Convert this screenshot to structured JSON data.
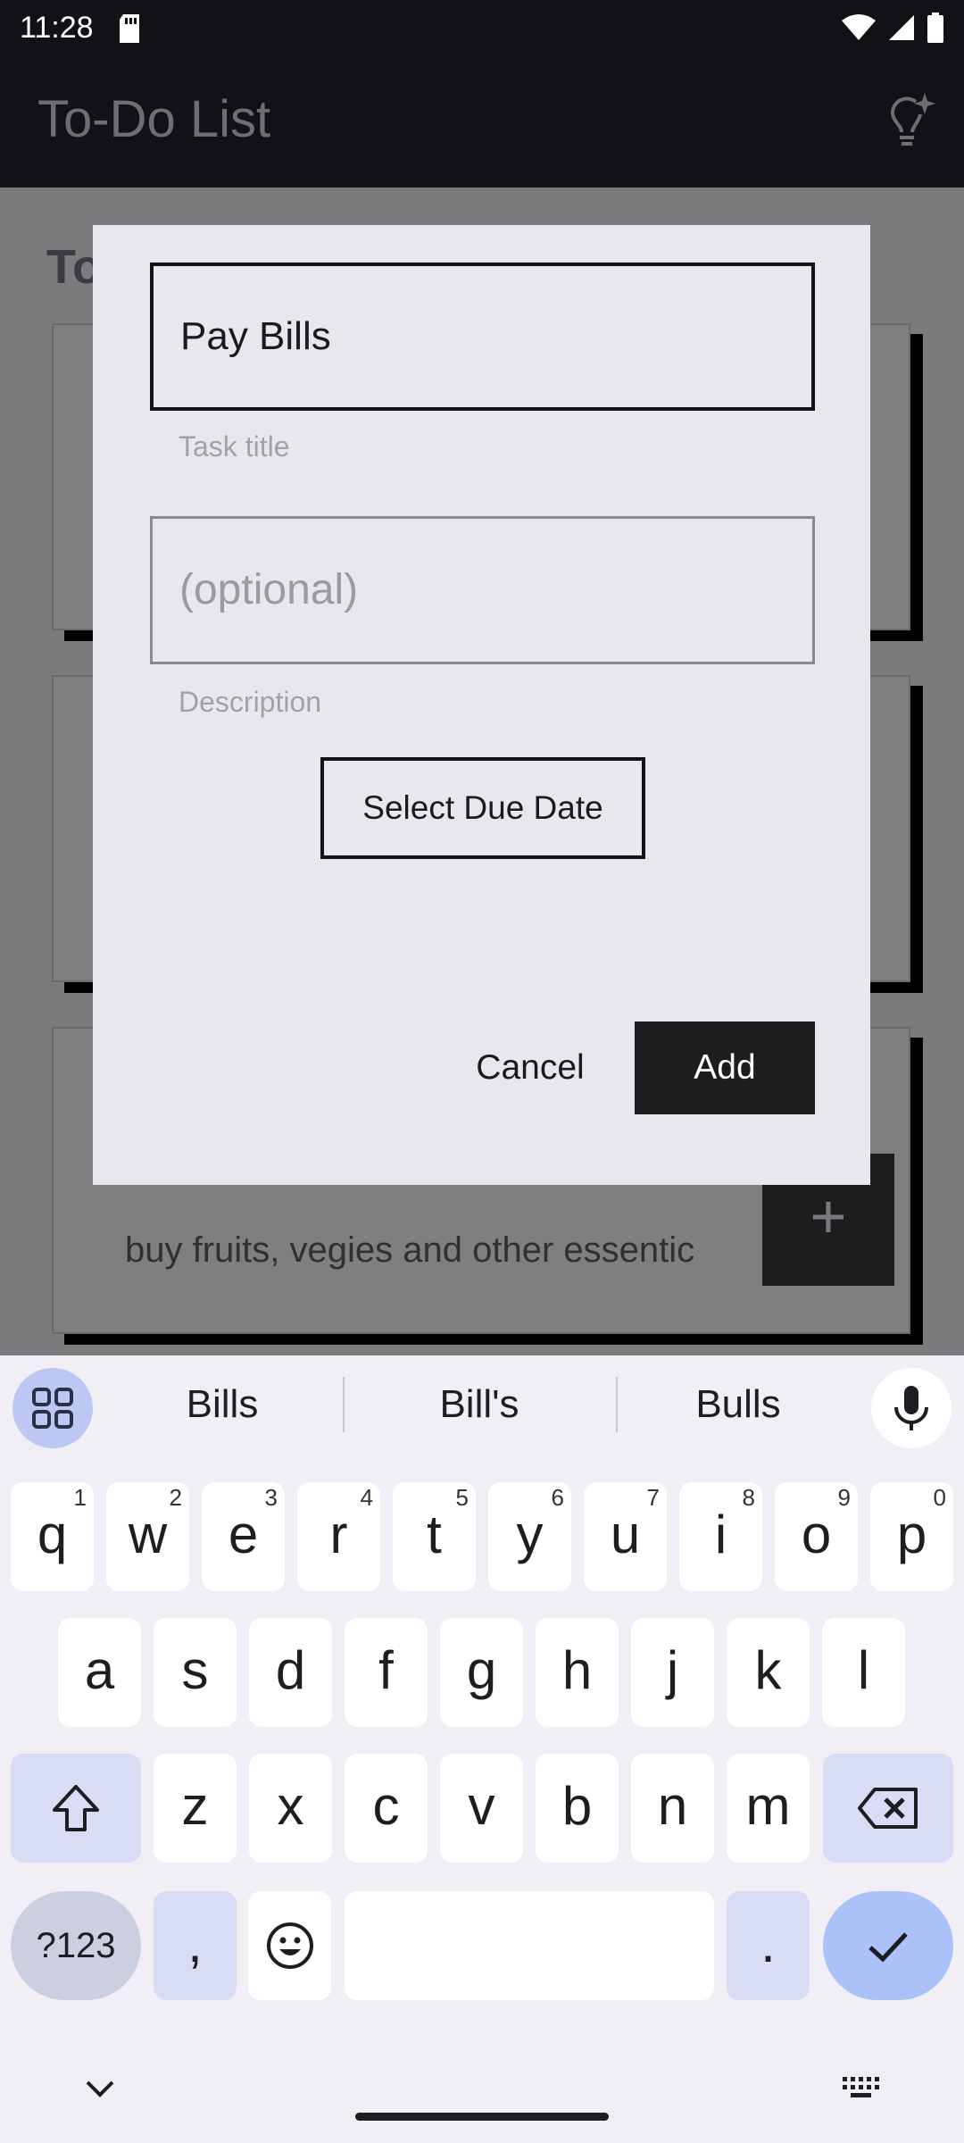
{
  "status_bar": {
    "time": "11:28"
  },
  "app_bar": {
    "title": "To-Do List"
  },
  "list": {
    "heading": "To",
    "card_3_text": "buy fruits, vegies and other essentic",
    "fab_label": "+"
  },
  "dialog": {
    "title_value": "Pay Bills",
    "title_helper": "Task title",
    "description_placeholder": "(optional)",
    "description_helper": "Description",
    "due_date_button": "Select Due Date",
    "cancel_button": "Cancel",
    "add_button": "Add"
  },
  "keyboard": {
    "suggestions": [
      "Bills",
      "Bill's",
      "Bulls"
    ],
    "row1": [
      {
        "key": "q",
        "hint": "1"
      },
      {
        "key": "w",
        "hint": "2"
      },
      {
        "key": "e",
        "hint": "3"
      },
      {
        "key": "r",
        "hint": "4"
      },
      {
        "key": "t",
        "hint": "5"
      },
      {
        "key": "y",
        "hint": "6"
      },
      {
        "key": "u",
        "hint": "7"
      },
      {
        "key": "i",
        "hint": "8"
      },
      {
        "key": "o",
        "hint": "9"
      },
      {
        "key": "p",
        "hint": "0"
      }
    ],
    "row2": [
      "a",
      "s",
      "d",
      "f",
      "g",
      "h",
      "j",
      "k",
      "l"
    ],
    "row3": [
      "z",
      "x",
      "c",
      "v",
      "b",
      "n",
      "m"
    ],
    "symbols_key": "?123",
    "comma_key": ",",
    "period_key": "."
  },
  "colors": {
    "app_bar": "#121216",
    "dialog_bg": "#e9e7ee",
    "primary_button": "#1d1d20",
    "keyboard_accent": "#aac2f7"
  },
  "icons": [
    "sd-card-icon",
    "wifi-icon",
    "signal-icon",
    "battery-icon",
    "lightbulb-sparkle-icon",
    "apps-grid-icon",
    "microphone-icon",
    "shift-icon",
    "backspace-icon",
    "emoji-icon",
    "checkmark-icon",
    "chevron-down-icon",
    "keyboard-switch-icon"
  ]
}
